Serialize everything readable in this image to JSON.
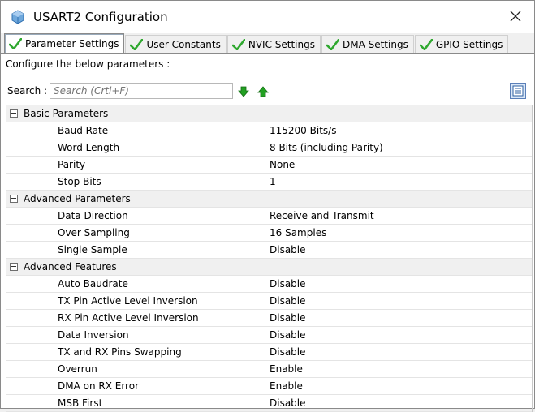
{
  "window": {
    "title": "USART2 Configuration"
  },
  "tabs": [
    {
      "label": "Parameter Settings",
      "active": true
    },
    {
      "label": "User Constants",
      "active": false
    },
    {
      "label": "NVIC Settings",
      "active": false
    },
    {
      "label": "DMA Settings",
      "active": false
    },
    {
      "label": "GPIO Settings",
      "active": false
    }
  ],
  "panel": {
    "configure_label": "Configure the below parameters :",
    "search_label": "Search :",
    "search_placeholder": "Search (Crtl+F)"
  },
  "groups": [
    {
      "label": "Basic Parameters",
      "params": [
        {
          "name": "Baud Rate",
          "value": "115200 Bits/s"
        },
        {
          "name": "Word Length",
          "value": "8 Bits (including Parity)"
        },
        {
          "name": "Parity",
          "value": "None"
        },
        {
          "name": "Stop Bits",
          "value": "1"
        }
      ]
    },
    {
      "label": "Advanced Parameters",
      "params": [
        {
          "name": "Data Direction",
          "value": "Receive and Transmit"
        },
        {
          "name": "Over Sampling",
          "value": "16 Samples"
        },
        {
          "name": "Single Sample",
          "value": "Disable"
        }
      ]
    },
    {
      "label": "Advanced Features",
      "params": [
        {
          "name": "Auto Baudrate",
          "value": "Disable"
        },
        {
          "name": "TX Pin Active Level Inversion",
          "value": "Disable"
        },
        {
          "name": "RX Pin Active Level Inversion",
          "value": "Disable"
        },
        {
          "name": "Data Inversion",
          "value": "Disable"
        },
        {
          "name": "TX and RX Pins Swapping",
          "value": "Disable"
        },
        {
          "name": "Overrun",
          "value": "Enable"
        },
        {
          "name": "DMA on RX Error",
          "value": "Enable"
        },
        {
          "name": "MSB First",
          "value": "Disable"
        }
      ]
    }
  ],
  "icons": {
    "app": "cube-icon",
    "close": "close-icon",
    "tab_check": "green-check-icon",
    "search_down": "green-arrow-down-icon",
    "search_up": "green-arrow-up-icon",
    "view_toggle": "list-view-icon"
  },
  "colors": {
    "check_green": "#2fa82f",
    "arrow_green": "#22a022",
    "view_button_bg": "#dbe8f8"
  }
}
